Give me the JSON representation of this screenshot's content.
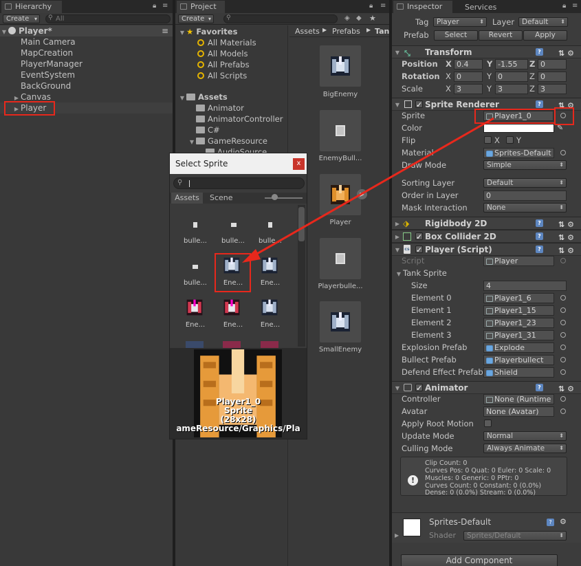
{
  "hierarchy": {
    "tab": "Hierarchy",
    "create": "Create",
    "search_placeholder": "All",
    "scene": "Player*",
    "items": [
      "Main Camera",
      "MapCreation",
      "PlayerManager",
      "EventSystem",
      "BackGround",
      "Canvas",
      "Player"
    ]
  },
  "project": {
    "tab": "Project",
    "create": "Create",
    "favorites_label": "Favorites",
    "favorites": [
      "All Materials",
      "All Models",
      "All Prefabs",
      "All Scripts"
    ],
    "assets_label": "Assets",
    "folders": [
      "Animator",
      "AnimatorController",
      "C#",
      "GameResource",
      "AudioSource"
    ],
    "breadcrumb": [
      "Assets",
      "Prefabs",
      "Tan"
    ],
    "prefabs": [
      "BigEnemy",
      "EnemyBull...",
      "Player",
      "Playerbulle...",
      "SmallEnemy"
    ]
  },
  "select_sprite": {
    "title": "Select Sprite",
    "close": "x",
    "tabs": [
      "Assets",
      "Scene"
    ],
    "items": [
      "bulle...",
      "bulle...",
      "bulle...",
      "bulle...",
      "Ene...",
      "Ene...",
      "Ene...",
      "Ene...",
      "Ene..."
    ],
    "preview": {
      "name": "Player1_0",
      "type": "Sprite",
      "size": "(28x28)",
      "path": "ameResource/Graphics/Pla"
    }
  },
  "inspector": {
    "tab": "Inspector",
    "tab2": "Services",
    "tag_label": "Tag",
    "tag": "Player",
    "layer_label": "Layer",
    "layer": "Default",
    "prefab_label": "Prefab",
    "select": "Select",
    "revert": "Revert",
    "apply": "Apply",
    "transform": {
      "title": "Transform",
      "position": "Position",
      "rotation": "Rotation",
      "scale": "Scale",
      "pos": [
        "0.4",
        "-1.55",
        "0"
      ],
      "rot": [
        "0",
        "0",
        "0"
      ],
      "scl": [
        "3",
        "3",
        "3"
      ],
      "axes": [
        "X",
        "Y",
        "Z"
      ]
    },
    "sprite_renderer": {
      "title": "Sprite Renderer",
      "sprite_label": "Sprite",
      "sprite": "Player1_0",
      "color_label": "Color",
      "flip_label": "Flip",
      "flip_x": "X",
      "flip_y": "Y",
      "material_label": "Material",
      "material": "Sprites-Default",
      "drawmode_label": "Draw Mode",
      "drawmode": "Simple",
      "sortlayer_label": "Sorting Layer",
      "sortlayer": "Default",
      "order_label": "Order in Layer",
      "order": "0",
      "mask_label": "Mask Interaction",
      "mask": "None"
    },
    "rigidbody": "Rigidbody 2D",
    "boxcollider": "Box Collider 2D",
    "player_script": {
      "title": "Player (Script)",
      "script_label": "Script",
      "script": "Player",
      "tank_sprite": "Tank Sprite",
      "size_label": "Size",
      "size": "4",
      "elements": [
        {
          "label": "Element 0",
          "value": "Player1_6"
        },
        {
          "label": "Element 1",
          "value": "Player1_15"
        },
        {
          "label": "Element 2",
          "value": "Player1_23"
        },
        {
          "label": "Element 3",
          "value": "Player1_31"
        }
      ],
      "explosion_label": "Explosion Prefab",
      "explosion": "Explode",
      "bullet_label": "Bullect Prefab",
      "bullet": "Playerbullect",
      "defend_label": "Defend Effect Prefab",
      "defend": "Shield"
    },
    "animator": {
      "title": "Animator",
      "controller_label": "Controller",
      "controller": "None (Runtime",
      "avatar_label": "Avatar",
      "avatar": "None (Avatar)",
      "root_label": "Apply Root Motion",
      "update_label": "Update Mode",
      "update": "Normal",
      "culling_label": "Culling Mode",
      "culling": "Always Animate",
      "info": [
        "Clip Count: 0",
        "Curves Pos: 0 Quat: 0 Euler: 0 Scale: 0",
        "Muscles: 0 Generic: 0 PPtr: 0",
        "Curves Count: 0 Constant: 0 (0.0%)",
        "Dense: 0 (0.0%) Stream: 0 (0.0%)"
      ]
    },
    "material": {
      "name": "Sprites-Default",
      "shader_label": "Shader",
      "shader": "Sprites/Default"
    },
    "add_component": "Add Component"
  },
  "colors": {
    "highlight": "#e8281c"
  }
}
